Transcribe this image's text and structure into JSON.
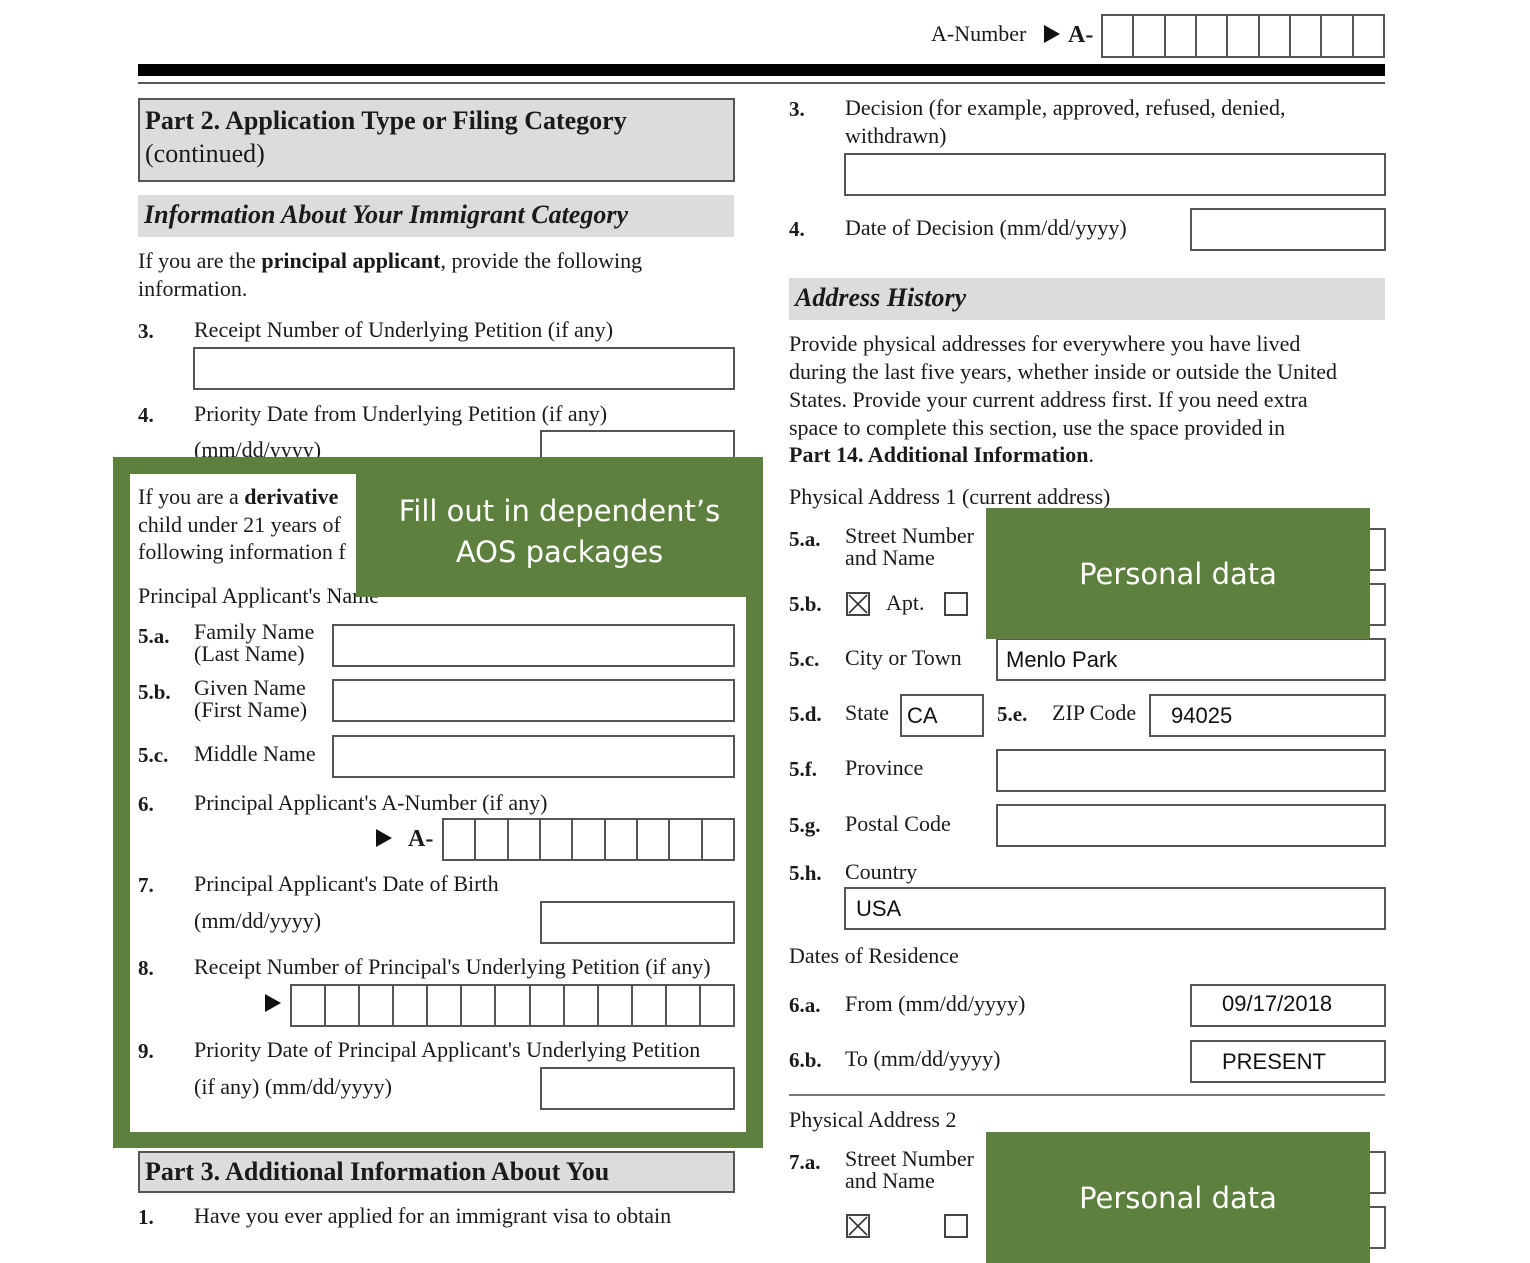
{
  "header": {
    "a_number_label": "A-Number",
    "a_prefix": "A-",
    "a_number_cells": 9
  },
  "left": {
    "part2_title": "Part 2.  Application Type or Filing Category",
    "part2_continued": "(continued)",
    "section_title": "Information About Your Immigrant Category",
    "principal_intro_1": "If you are the ",
    "principal_intro_bold": "principal applicant",
    "principal_intro_2": ", provide the following",
    "principal_intro_3": "information.",
    "items": [
      {
        "num": "3.",
        "label": "Receipt Number of Underlying Petition (if any)"
      },
      {
        "num": "4.",
        "label": "Priority Date from Underlying Petition (if any)",
        "sub": "(mm/dd/yyyy)"
      }
    ],
    "derivative_intro_1": "If you are a ",
    "derivative_intro_bold": "derivative",
    "derivative_intro_2": "child under 21 years of",
    "derivative_intro_3": "following information f",
    "principal_name_heading": "Principal Applicant's Name",
    "name_fields": [
      {
        "num": "5.a.",
        "label1": "Family Name",
        "label2": "(Last Name)",
        "value": ""
      },
      {
        "num": "5.b.",
        "label1": "Given Name",
        "label2": "(First Name)",
        "value": ""
      },
      {
        "num": "5.c.",
        "label1": "Middle Name",
        "label2": "",
        "value": ""
      }
    ],
    "item6": {
      "num": "6.",
      "label": "Principal Applicant's A-Number (if any)",
      "prefix": "A-",
      "cells": 9
    },
    "item7": {
      "num": "7.",
      "label": "Principal Applicant's Date of Birth",
      "sub": "(mm/dd/yyyy)",
      "value": ""
    },
    "item8": {
      "num": "8.",
      "label": "Receipt Number of Principal's Underlying Petition (if any)",
      "cells": 13
    },
    "item9": {
      "num": "9.",
      "label": "Priority Date of Principal Applicant's Underlying Petition",
      "sub": "(if any) (mm/dd/yyyy)",
      "value": ""
    },
    "part3_title": "Part 3.  Additional Information About You",
    "part3_item1_num": "1.",
    "part3_item1_label": "Have you ever applied for an immigrant visa to obtain"
  },
  "right": {
    "item3": {
      "num": "3.",
      "label1": "Decision (for example, approved, refused, denied,",
      "label2": "withdrawn)",
      "value": ""
    },
    "item4": {
      "num": "4.",
      "label": "Date of Decision (mm/dd/yyyy)",
      "value": ""
    },
    "address_history_title": "Address History",
    "address_intro": [
      "Provide physical addresses for everywhere you have lived",
      "during the last five years, whether inside or outside the United",
      "States.  Provide your current address first.  If you need extra",
      "space to complete this section, use the space provided in"
    ],
    "address_intro_bold": "Part 14. Additional Information",
    "address_intro_end": ".",
    "address1_heading": "Physical Address 1 (current address)",
    "street": {
      "num": "5.a.",
      "label1": "Street Number",
      "label2": "and Name"
    },
    "unit": {
      "num": "5.b.",
      "apt_checked": true,
      "apt_label": "Apt.",
      "ste_checked": false
    },
    "city": {
      "num": "5.c.",
      "label": "City or Town",
      "value": "Menlo Park"
    },
    "state": {
      "num": "5.d.",
      "label": "State",
      "value": "CA"
    },
    "zip": {
      "num": "5.e.",
      "label": "ZIP Code",
      "value": "94025"
    },
    "province": {
      "num": "5.f.",
      "label": "Province",
      "value": ""
    },
    "postal": {
      "num": "5.g.",
      "label": "Postal Code",
      "value": ""
    },
    "country": {
      "num": "5.h.",
      "label": "Country",
      "value": "USA"
    },
    "dates_heading": "Dates of Residence",
    "from": {
      "num": "6.a.",
      "label": "From (mm/dd/yyyy)",
      "value": "09/17/2018"
    },
    "to": {
      "num": "6.b.",
      "label": "To (mm/dd/yyyy)",
      "value": "PRESENT"
    },
    "address2_heading": "Physical Address 2",
    "street2": {
      "num": "7.a.",
      "label1": "Street Number",
      "label2": "and Name"
    }
  },
  "annotations": {
    "dependent_callout": [
      "Fill out in dependent’s",
      "AOS packages"
    ],
    "personal_data_1": "Personal data",
    "personal_data_2": "Personal data",
    "overlay_color": "#5e803e"
  }
}
